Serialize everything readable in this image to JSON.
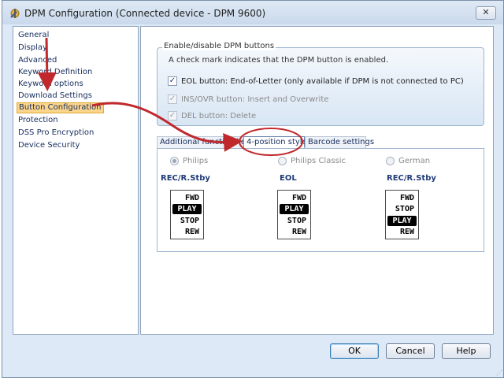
{
  "window": {
    "title": "DPM Configuration (Connected device - DPM 9600)",
    "close_label": "✕",
    "icon": "settings-app-icon"
  },
  "sidebar": {
    "items": [
      {
        "label": "General"
      },
      {
        "label": "Display"
      },
      {
        "label": "Advanced"
      },
      {
        "label": "Keyword Definition"
      },
      {
        "label": "Keyword options"
      },
      {
        "label": "Download Settings"
      },
      {
        "label": "Button Configuration",
        "selected": true
      },
      {
        "label": "Protection"
      },
      {
        "label": "DSS Pro Encryption"
      },
      {
        "label": "Device Security"
      }
    ]
  },
  "group": {
    "legend": "Enable/disable DPM buttons",
    "description": "A check mark indicates that the DPM button is enabled.",
    "options": [
      {
        "label": "EOL button: End-of-Letter (only available if DPM is not connected to PC)",
        "checked": true,
        "enabled": true
      },
      {
        "label": "INS/OVR button: Insert and Overwrite",
        "checked": true,
        "enabled": false
      },
      {
        "label": "DEL button: Delete",
        "checked": true,
        "enabled": false
      }
    ]
  },
  "tabs": [
    {
      "label": "Additional function key",
      "active": false
    },
    {
      "label": "4-position style",
      "active": true
    },
    {
      "label": "Barcode settings",
      "active": false
    }
  ],
  "styles": [
    {
      "radio_label": "Philips",
      "checked": true,
      "mode_title": "REC/R.Stby",
      "positions": [
        "FWD",
        "PLAY",
        "STOP",
        "REW"
      ],
      "highlight": "PLAY"
    },
    {
      "radio_label": "Philips Classic",
      "checked": false,
      "mode_title": "EOL",
      "positions": [
        "FWD",
        "PLAY",
        "STOP",
        "REW"
      ],
      "highlight": "PLAY"
    },
    {
      "radio_label": "German",
      "checked": false,
      "mode_title": "REC/R.Stby",
      "positions": [
        "FWD",
        "STOP",
        "PLAY",
        "REW"
      ],
      "highlight": "PLAY"
    }
  ],
  "footer": {
    "ok_label": "OK",
    "cancel_label": "Cancel",
    "help_label": "Help"
  },
  "colors": {
    "annotation": "#c0282c",
    "selection": "#fbd58a",
    "heading_blue": "#1f3a78"
  }
}
